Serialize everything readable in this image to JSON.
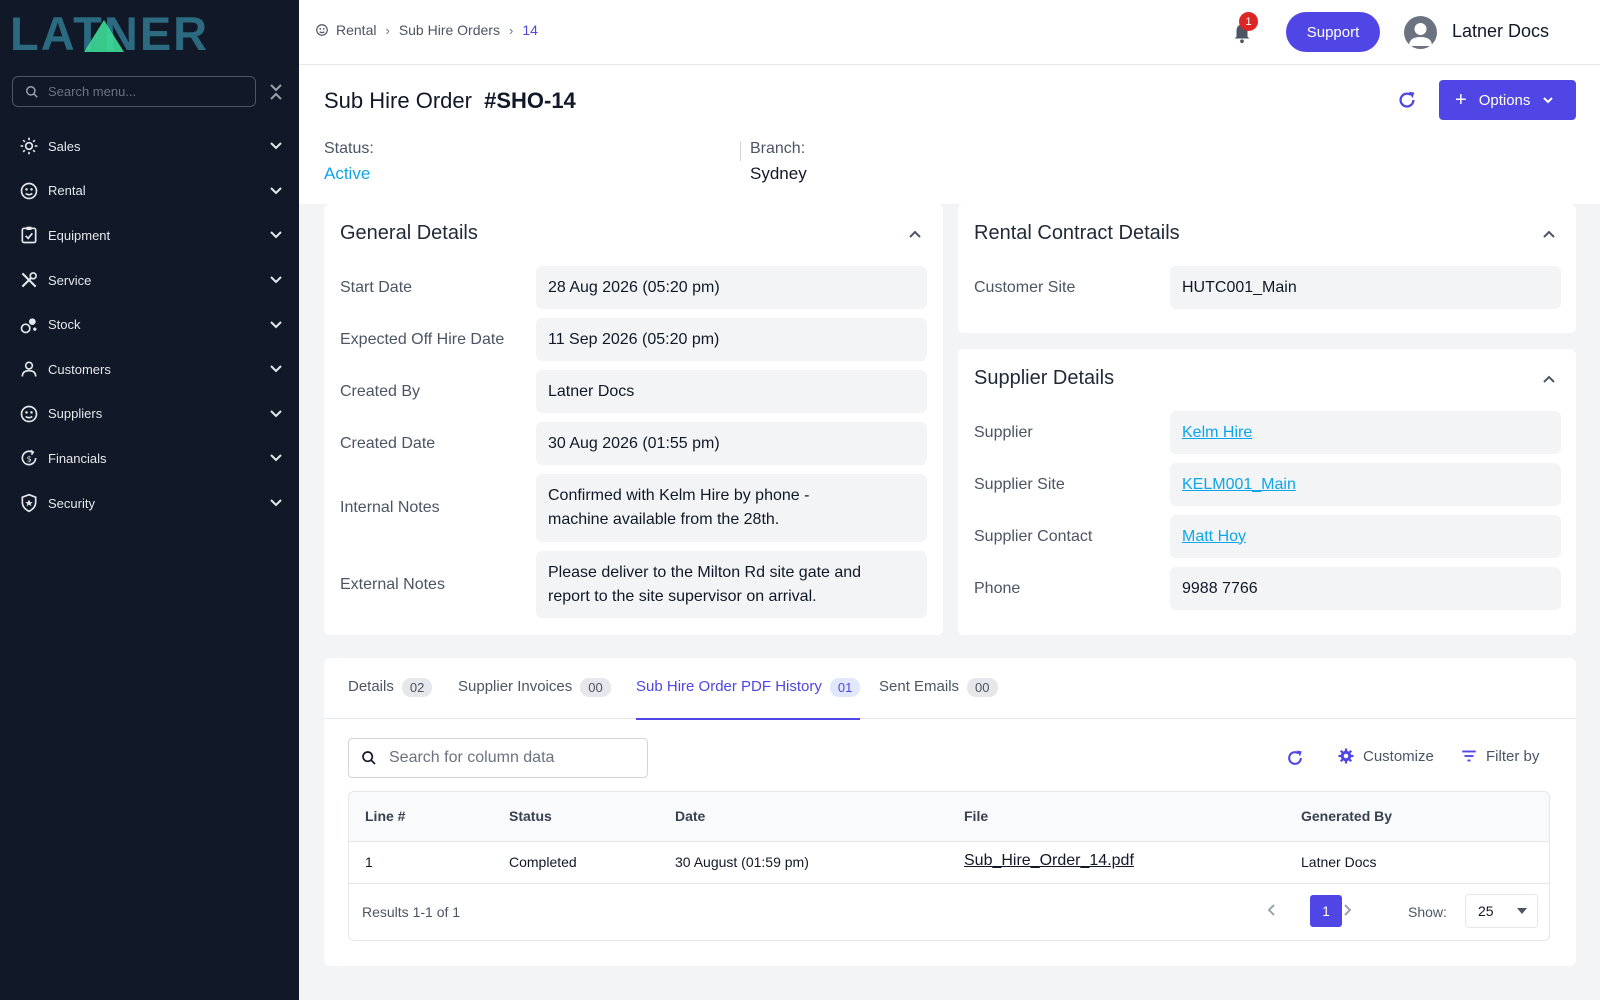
{
  "sidebar": {
    "logo_text": "LATNER",
    "search_placeholder": "Search menu...",
    "items": [
      {
        "label": "Sales",
        "icon": "sales-icon"
      },
      {
        "label": "Rental",
        "icon": "rental-icon"
      },
      {
        "label": "Equipment",
        "icon": "equipment-icon"
      },
      {
        "label": "Service",
        "icon": "service-icon"
      },
      {
        "label": "Stock",
        "icon": "stock-icon"
      },
      {
        "label": "Customers",
        "icon": "customers-icon"
      },
      {
        "label": "Suppliers",
        "icon": "suppliers-icon"
      },
      {
        "label": "Financials",
        "icon": "financials-icon"
      },
      {
        "label": "Security",
        "icon": "security-icon"
      }
    ]
  },
  "topbar": {
    "breadcrumb": [
      "Rental",
      "Sub Hire Orders",
      "14"
    ],
    "notification_count": "1",
    "support_label": "Support",
    "username": "Latner Docs"
  },
  "header": {
    "title": "Sub Hire Order",
    "code": "#SHO-14",
    "options_label": "Options",
    "status_label": "Status:",
    "status_value": "Active",
    "branch_label": "Branch:",
    "branch_value": "Sydney"
  },
  "general": {
    "title": "General Details",
    "rows": [
      {
        "label": "Start Date",
        "value": "28 Aug 2026 (05:20 pm)"
      },
      {
        "label": "Expected Off Hire Date",
        "value": "11 Sep 2026 (05:20 pm)"
      },
      {
        "label": "Created By",
        "value": "Latner Docs"
      },
      {
        "label": "Created Date",
        "value": "30 Aug 2026 (01:55 pm)"
      },
      {
        "label": "Internal Notes",
        "value": "Confirmed with Kelm Hire by phone - machine available from the 28th."
      },
      {
        "label": "External Notes",
        "value": "Please deliver to the Milton Rd site gate and report to the site supervisor on arrival."
      }
    ]
  },
  "contract": {
    "title": "Rental Contract Details",
    "rows": [
      {
        "label": "Customer Site",
        "value": "HUTC001_Main"
      }
    ]
  },
  "supplier": {
    "title": "Supplier Details",
    "rows": [
      {
        "label": "Supplier",
        "value": "Kelm Hire"
      },
      {
        "label": "Supplier Site",
        "value": "KELM001_Main"
      },
      {
        "label": "Supplier Contact",
        "value": "Matt Hoy"
      },
      {
        "label": "Phone",
        "value": "9988 7766"
      }
    ]
  },
  "tabs": [
    {
      "label": "Details",
      "count": "02"
    },
    {
      "label": "Supplier Invoices",
      "count": "00"
    },
    {
      "label": "Sub Hire Order PDF History",
      "count": "01"
    },
    {
      "label": "Sent Emails",
      "count": "00"
    }
  ],
  "table": {
    "search_placeholder": "Search for column data",
    "customize_label": "Customize",
    "filter_label": "Filter by",
    "columns": [
      "Line #",
      "Status",
      "Date",
      "File",
      "Generated By"
    ],
    "rows": [
      [
        "1",
        "Completed",
        "30 August (01:59 pm)",
        "Sub_Hire_Order_14.pdf",
        "Latner Docs"
      ]
    ],
    "results": "Results 1-1 of 1",
    "page": "1",
    "show_label": "Show:",
    "show_value": "25"
  },
  "colors": {
    "accent": "#4f46e5",
    "sidebar_bg": "#111827",
    "link": "#0ea5e9",
    "badge": "#dc2626"
  }
}
